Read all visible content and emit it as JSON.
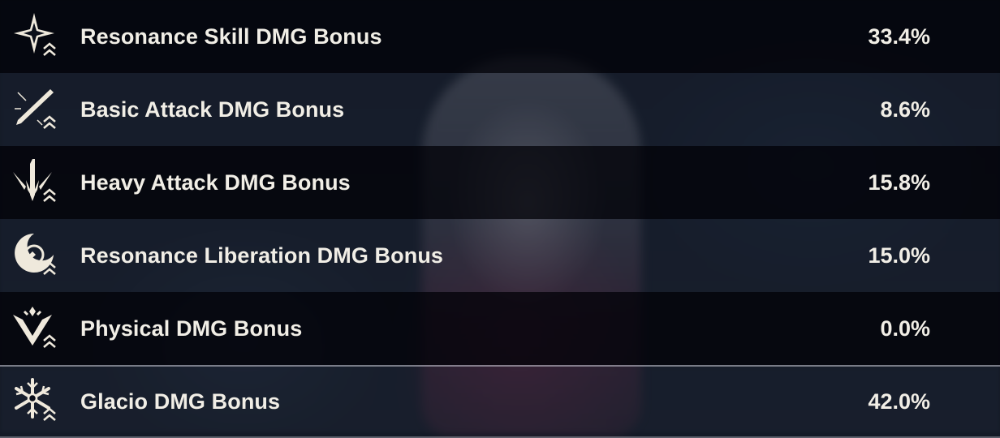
{
  "stats": [
    {
      "label": "Resonance Skill DMG Bonus",
      "value": "33.4%",
      "icon": "resonance-skill-icon"
    },
    {
      "label": "Basic Attack DMG Bonus",
      "value": "8.6%",
      "icon": "basic-attack-icon"
    },
    {
      "label": "Heavy Attack DMG Bonus",
      "value": "15.8%",
      "icon": "heavy-attack-icon"
    },
    {
      "label": "Resonance Liberation DMG Bonus",
      "value": "15.0%",
      "icon": "resonance-liberation-icon"
    },
    {
      "label": "Physical DMG Bonus",
      "value": "0.0%",
      "icon": "physical-icon"
    },
    {
      "label": "Glacio DMG Bonus",
      "value": "42.0%",
      "icon": "glacio-icon"
    }
  ],
  "colors": {
    "text": "#f1eee6",
    "row_dark": "#04060c",
    "row_light": "#1c2230"
  }
}
